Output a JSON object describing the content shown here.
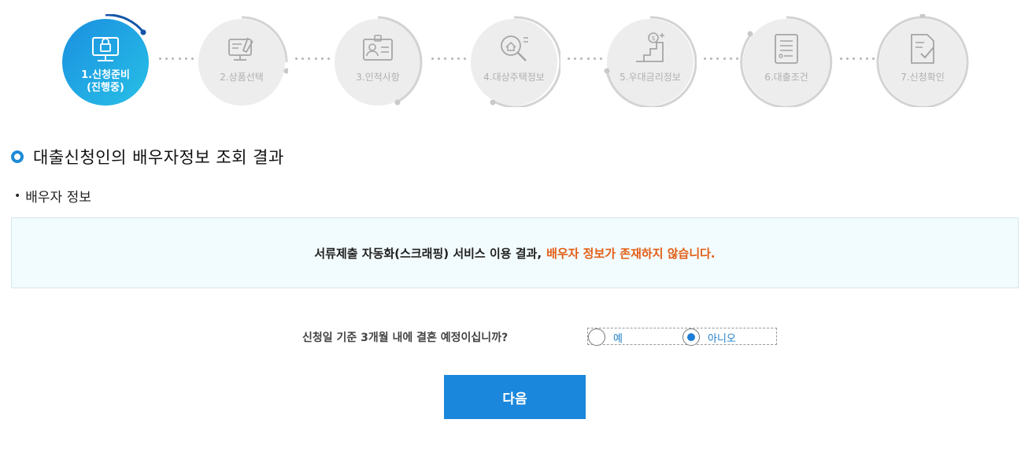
{
  "steps": [
    {
      "label_line1": "1.신청준비",
      "label_line2": "(진행중)",
      "icon": "computer-lock-icon",
      "state": "active"
    },
    {
      "label_line1": "2.상품선택",
      "icon": "monitor-wrench-icon",
      "state": "pending"
    },
    {
      "label_line1": "3.인적사항",
      "icon": "id-card-icon",
      "state": "pending"
    },
    {
      "label_line1": "4.대상주택정보",
      "icon": "house-search-icon",
      "state": "pending"
    },
    {
      "label_line1": "5.우대금리정보",
      "icon": "stairs-coin-icon",
      "state": "pending"
    },
    {
      "label_line1": "6.대출조건",
      "icon": "document-list-icon",
      "state": "pending"
    },
    {
      "label_line1": "7.신청확인",
      "icon": "document-check-icon",
      "state": "pending"
    }
  ],
  "section": {
    "title": "대출신청인의 배우자정보 조회 결과"
  },
  "subsection": {
    "bullet": "•",
    "title": "배우자 정보"
  },
  "notice": {
    "text": "서류제출 자동화(스크래핑) 서비스 이용 결과,",
    "highlight": "배우자 정보가 존재하지 않습니다."
  },
  "question": {
    "text": "신청일 기준 3개월 내에 결혼 예정이십니까?",
    "options": [
      {
        "label": "예",
        "checked": false
      },
      {
        "label": "아니오",
        "checked": true
      }
    ]
  },
  "next_button": {
    "label": "다음"
  },
  "colors": {
    "accent": "#1e8ad6",
    "highlight": "#e35e16",
    "button": "#1a87dc"
  }
}
